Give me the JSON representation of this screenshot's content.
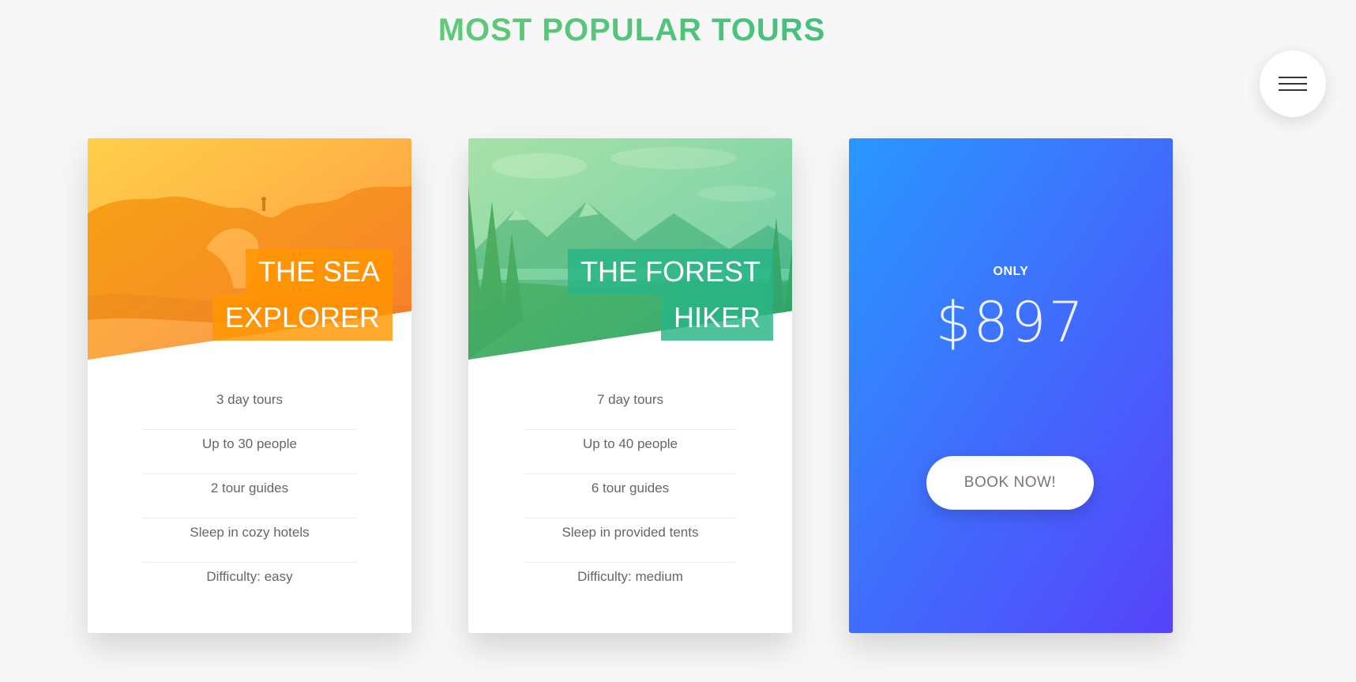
{
  "section": {
    "title": "MOST POPULAR TOURS"
  },
  "menu": {
    "icon": "hamburger-icon"
  },
  "tours": [
    {
      "heading_line1": "THE SEA",
      "heading_line2": "EXPLORER",
      "details": [
        "3 day tours",
        "Up to 30 people",
        "2 tour guides",
        "Sleep in cozy hotels",
        "Difficulty: easy"
      ],
      "accent": "#ff9500"
    },
    {
      "heading_line1": "THE FOREST",
      "heading_line2": "HIKER",
      "details": [
        "7 day tours",
        "Up to 40 people",
        "6 tour guides",
        "Sleep in provided tents",
        "Difficulty: medium"
      ],
      "accent": "#28b485"
    }
  ],
  "pricing": {
    "only_label": "ONLY",
    "price": "$897",
    "button_label": "BOOK NOW!",
    "gradient_start": "#2998ff",
    "gradient_end": "#5643fa"
  }
}
